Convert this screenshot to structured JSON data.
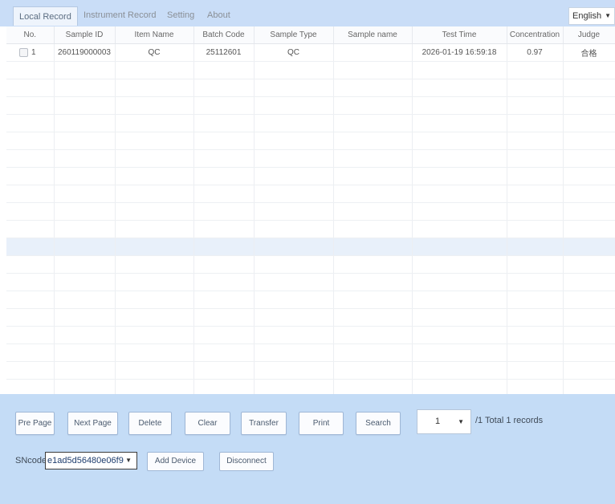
{
  "tabs": [
    "Local Record",
    "Instrument Record",
    "Setting",
    "About"
  ],
  "language": "English",
  "table": {
    "headers": [
      "No.",
      "Sample ID",
      "Item Name",
      "Batch Code",
      "Sample Type",
      "Sample name",
      "Test Time",
      "Concentration",
      "Judge"
    ],
    "rows": [
      [
        "1",
        "260119000003",
        "QC",
        "25112601",
        "QC",
        "",
        "2026-01-19 16:59:18",
        "0.97",
        "合格"
      ]
    ]
  },
  "footer": {
    "buttons": [
      "Pre Page",
      "Next Page",
      "Delete",
      "Clear",
      "Transfer",
      "Print",
      "Search"
    ],
    "page_value": "1",
    "total_text": "/1  Total 1 records",
    "sn_label": "SNcode",
    "sn_value": "e1ad5d56480e06f9",
    "add_device": "Add Device",
    "disconnect": "Disconnect"
  },
  "colors": {
    "tab_bar": "#c9ddf7",
    "footer": "#c4dcf6",
    "row_highlight": "#e8f0fa"
  }
}
